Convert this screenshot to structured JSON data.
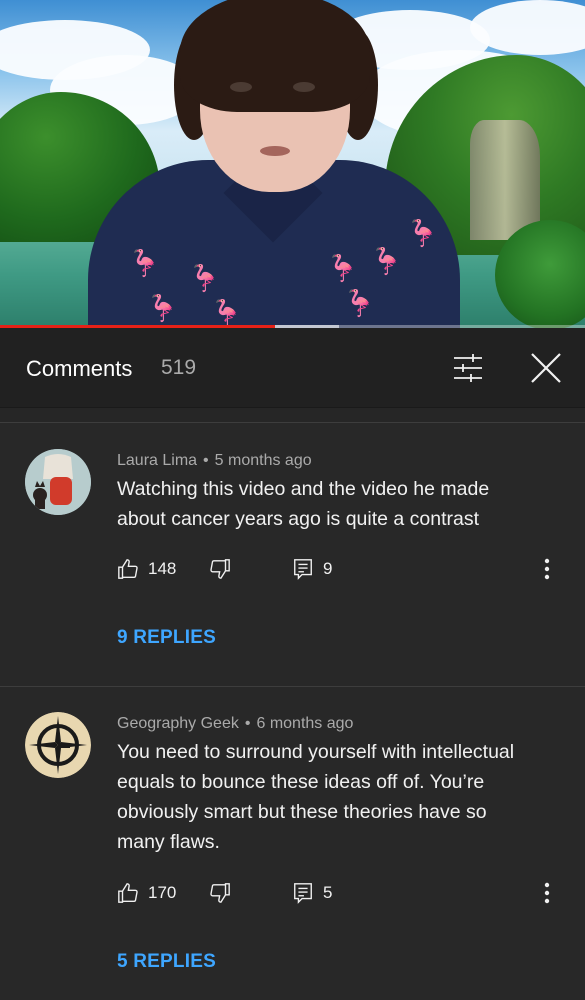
{
  "comments_panel": {
    "title": "Comments",
    "count": "519",
    "sort_icon": "sort-filter-icon",
    "close_icon": "close-icon"
  },
  "video": {
    "progress": 0.47,
    "buffered": 0.58,
    "progress_color": "#e62117"
  },
  "comments": [
    {
      "author": "Laura Lima",
      "time": "5 months ago",
      "text": "Watching this video and the video he made about cancer years ago is quite a contrast",
      "likes": "148",
      "reply_count": "9",
      "replies_label": "9 REPLIES"
    },
    {
      "author": "Geography Geek",
      "time": "6 months ago",
      "text": "You need to surround yourself with intellectual equals to bounce these ideas off of. You’re obviously smart but these theories have so many flaws.",
      "likes": "170",
      "reply_count": "5",
      "replies_label": "5 REPLIES"
    }
  ],
  "colors": {
    "background": "#282828",
    "header_bg": "#212121",
    "link_blue": "#3ea6ff",
    "meta_gray": "#aaaaaa"
  }
}
